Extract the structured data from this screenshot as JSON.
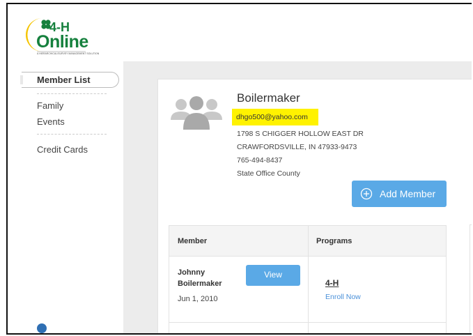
{
  "header": {
    "logo_top": "4-H",
    "logo_bottom": "Online",
    "logo_tagline": "A HIERARCHICAL/SURVEY MANAGEMENT SOLUTION"
  },
  "sidebar": {
    "active_item": "Member List",
    "items": [
      "Family",
      "Events",
      "Credit Cards"
    ]
  },
  "family": {
    "name": "Boilermaker",
    "email": "dhgo500@yahoo.com",
    "address_line1": "1798 S CHIGGER HOLLOW EAST DR",
    "address_line2": "CRAWFORDSVILLE, IN 47933-9473",
    "phone": "765-494-8437",
    "county": "State Office County"
  },
  "actions": {
    "add_member_label": "Add Member"
  },
  "members_table": {
    "headers": {
      "member": "Member",
      "programs": "Programs"
    },
    "rows": [
      {
        "first_name": "Johnny",
        "last_name": "Boilermaker",
        "dob": "Jun 1, 2010",
        "view_label": "View",
        "program": "4-H",
        "enroll_label": "Enroll Now"
      }
    ]
  },
  "colors": {
    "brand_green": "#15803d",
    "accent_blue": "#5aa9e6",
    "highlight": "#fff200"
  }
}
